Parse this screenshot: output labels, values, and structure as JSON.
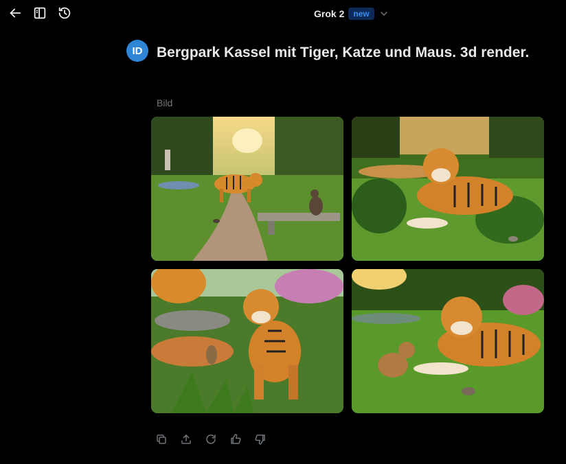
{
  "header": {
    "model_name": "Grok 2",
    "badge": "new",
    "icons": [
      "back-arrow-icon",
      "sidebar-toggle-icon",
      "history-icon",
      "chevron-down-icon"
    ]
  },
  "message": {
    "avatar_initials": "ID",
    "prompt_text": "Bergpark Kassel mit Tiger, Katze und Maus. 3d render.",
    "section_label": "Bild"
  },
  "images": [
    {
      "description_icon": "image-tiger-path-cat"
    },
    {
      "description_icon": "image-tiger-lying-pond"
    },
    {
      "description_icon": "image-tiger-standing-pond"
    },
    {
      "description_icon": "image-tiger-cat-mouse-grass"
    }
  ],
  "actions": [
    "copy-icon",
    "share-icon",
    "regenerate-icon",
    "thumbs-up-icon",
    "thumbs-down-icon"
  ],
  "colors": {
    "background": "#000000",
    "badge_bg": "#0b2a55",
    "badge_text": "#3b8cf5",
    "avatar": "#2f86d6",
    "muted": "#71767b"
  }
}
